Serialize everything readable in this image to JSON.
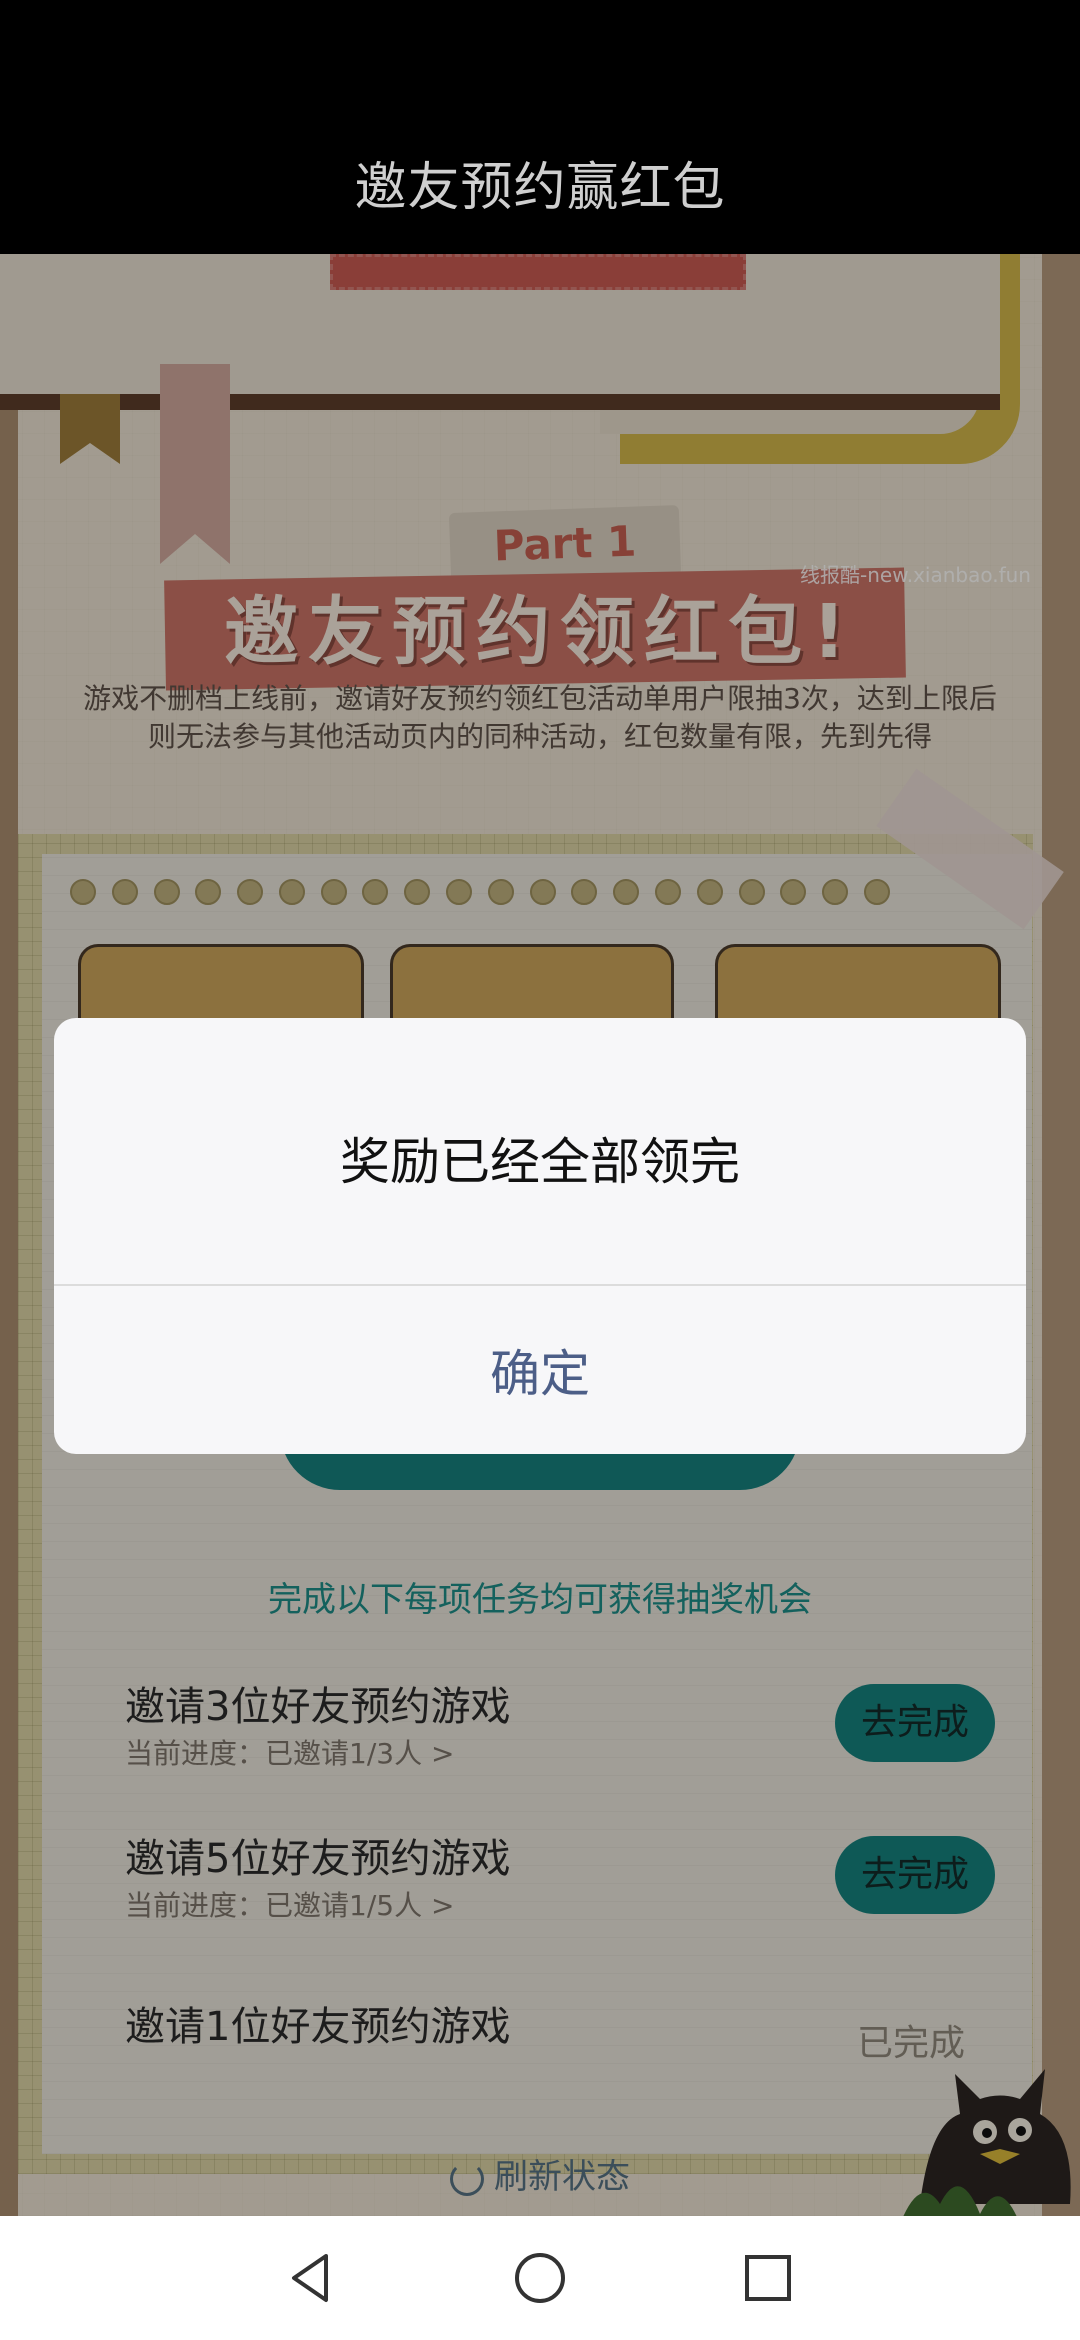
{
  "header": {
    "title": "邀友预约赢红包"
  },
  "banner": {
    "part_label": "Part 1",
    "heading": "邀友预约领红包!",
    "watermark": "线报酷-new.xianbao.fun",
    "intro_line1": "游戏不删档上线前，邀请好友预约领红包活动单用户限抽3次，达到上限后",
    "intro_line2": "则无法参与其他活动页内的同种活动，红包数量有限，先到先得"
  },
  "tasks_section": {
    "hint": "完成以下每项任务均可获得抽奖机会",
    "tasks": [
      {
        "title": "邀请3位好友预约游戏",
        "progress": "当前进度：已邀请1/3人 >",
        "action": "去完成"
      },
      {
        "title": "邀请5位好友预约游戏",
        "progress": "当前进度：已邀请1/5人 >",
        "action": "去完成"
      },
      {
        "title": "邀请1位好友预约游戏",
        "status": "已完成"
      }
    ],
    "refresh_label": "刷新状态"
  },
  "dialog": {
    "message": "奖励已经全部领完",
    "confirm_label": "确定"
  },
  "nav": {
    "back_icon": "triangle-back-icon",
    "home_icon": "circle-home-icon",
    "recents_icon": "square-recents-icon"
  },
  "colors": {
    "accent_teal": "#15807c",
    "dialog_button": "#4c5e87",
    "heading_red": "#c87265"
  }
}
